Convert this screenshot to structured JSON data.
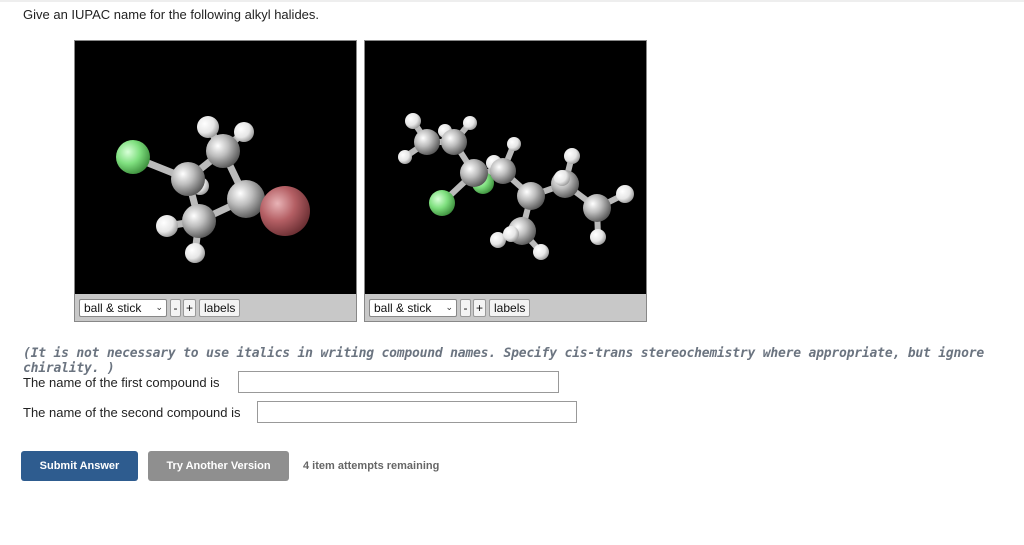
{
  "question": "Give an IUPAC name for the following alkyl halides.",
  "viewers": [
    {
      "style_option": "ball & stick",
      "minus": "-",
      "plus": "+",
      "labels": "labels"
    },
    {
      "style_option": "ball & stick",
      "minus": "-",
      "plus": "+",
      "labels": "labels"
    }
  ],
  "note": "(It is not necessary to use italics in writing compound names. Specify cis-trans stereochemistry where appropriate, but ignore chirality. )",
  "first_label": "The name of the first compound is",
  "first_value": "",
  "second_label": "The name of the second compound is",
  "second_value": "",
  "buttons": {
    "submit": "Submit Answer",
    "try_another": "Try Another Version"
  },
  "attempts": "4 item attempts remaining",
  "colors": {
    "submit_bg": "#2e5c8f",
    "try_bg": "#8f8f8f",
    "chlorine": "#7fe07f",
    "bromine": "#b45f64"
  }
}
